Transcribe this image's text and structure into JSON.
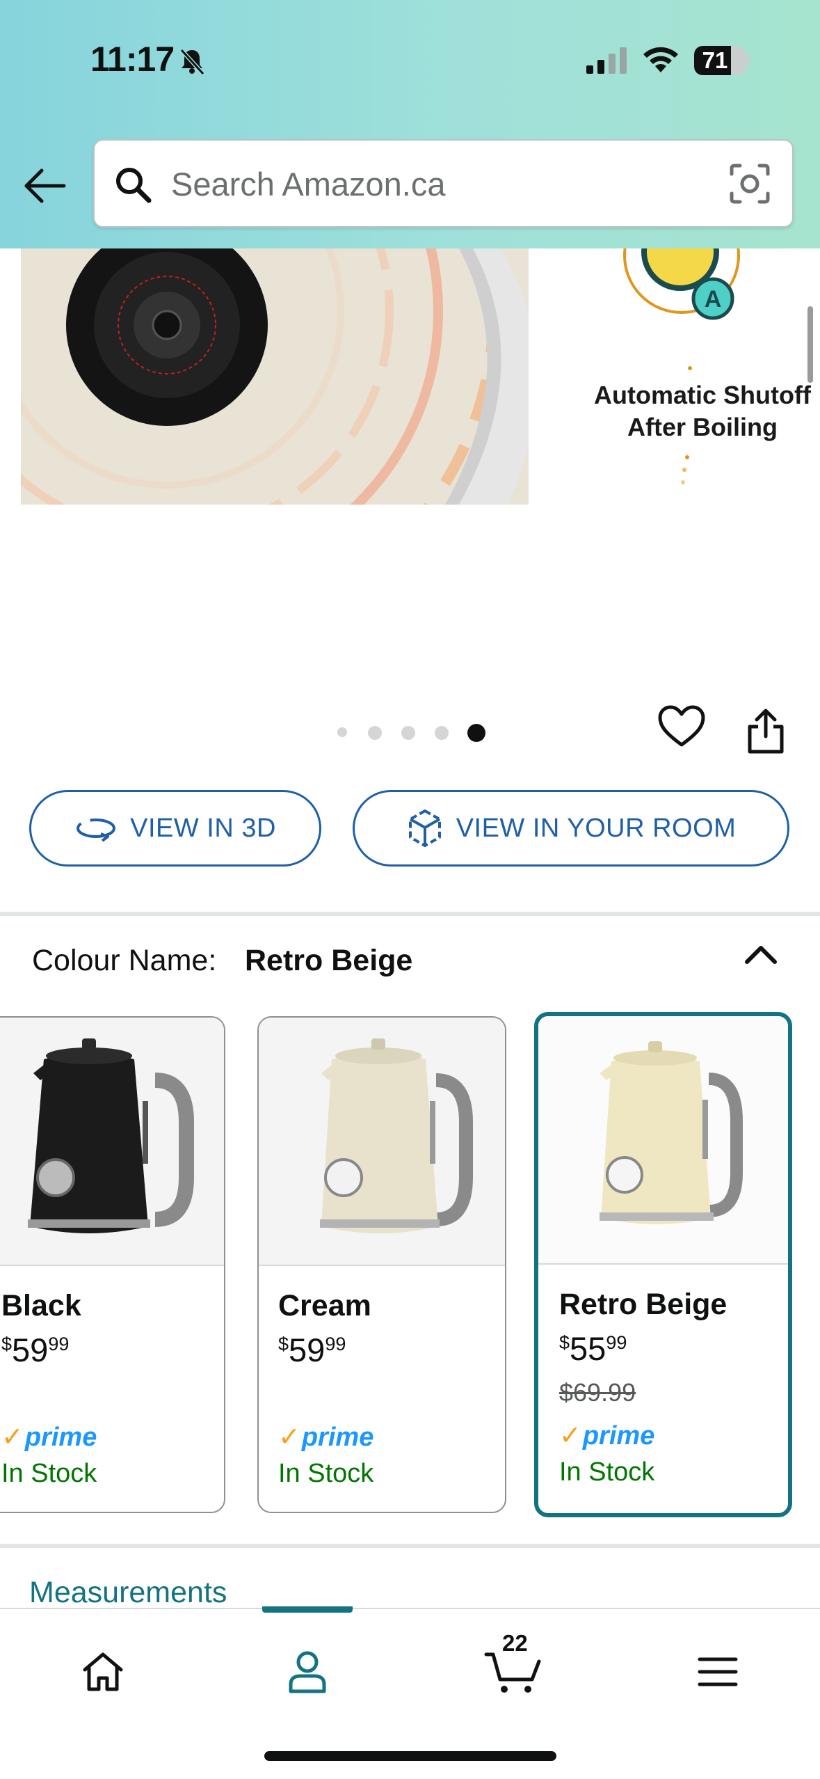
{
  "status_bar": {
    "time": "11:17",
    "battery": "71",
    "battery_fraction": 0.71
  },
  "search": {
    "placeholder": "Search Amazon.ca"
  },
  "product_image": {
    "caption_line1": "Automatic Shutoff",
    "caption_line2": "After Boiling",
    "dots_total": 5,
    "active_dot": 5
  },
  "actions": {
    "view_3d": "VIEW IN 3D",
    "view_room": "VIEW IN YOUR ROOM"
  },
  "colour": {
    "label": "Colour Name:",
    "selected": "Retro Beige",
    "options": [
      {
        "name": "Black",
        "currency": "$",
        "price_whole": "59",
        "price_fraction": "99",
        "was_price": "",
        "prime": "prime",
        "stock": "In Stock",
        "body_color": "#1b1b1b"
      },
      {
        "name": "Cream",
        "currency": "$",
        "price_whole": "59",
        "price_fraction": "99",
        "was_price": "",
        "prime": "prime",
        "stock": "In Stock",
        "body_color": "#e8e2cc"
      },
      {
        "name": "Retro Beige",
        "currency": "$",
        "price_whole": "55",
        "price_fraction": "99",
        "was_price": "$69.99",
        "prime": "prime",
        "stock": "In Stock",
        "body_color": "#efe6c2"
      }
    ]
  },
  "sections": {
    "measurements": "Measurements"
  },
  "bottom_nav": {
    "cart_count": "22",
    "items": [
      "home-icon",
      "account-icon",
      "cart-icon",
      "menu-icon"
    ],
    "active": "account-icon"
  },
  "colors": {
    "accent_teal": "#137380",
    "link_blue": "#1f5fa8",
    "prime_blue": "#1a98ff",
    "in_stock_green": "#007600"
  }
}
